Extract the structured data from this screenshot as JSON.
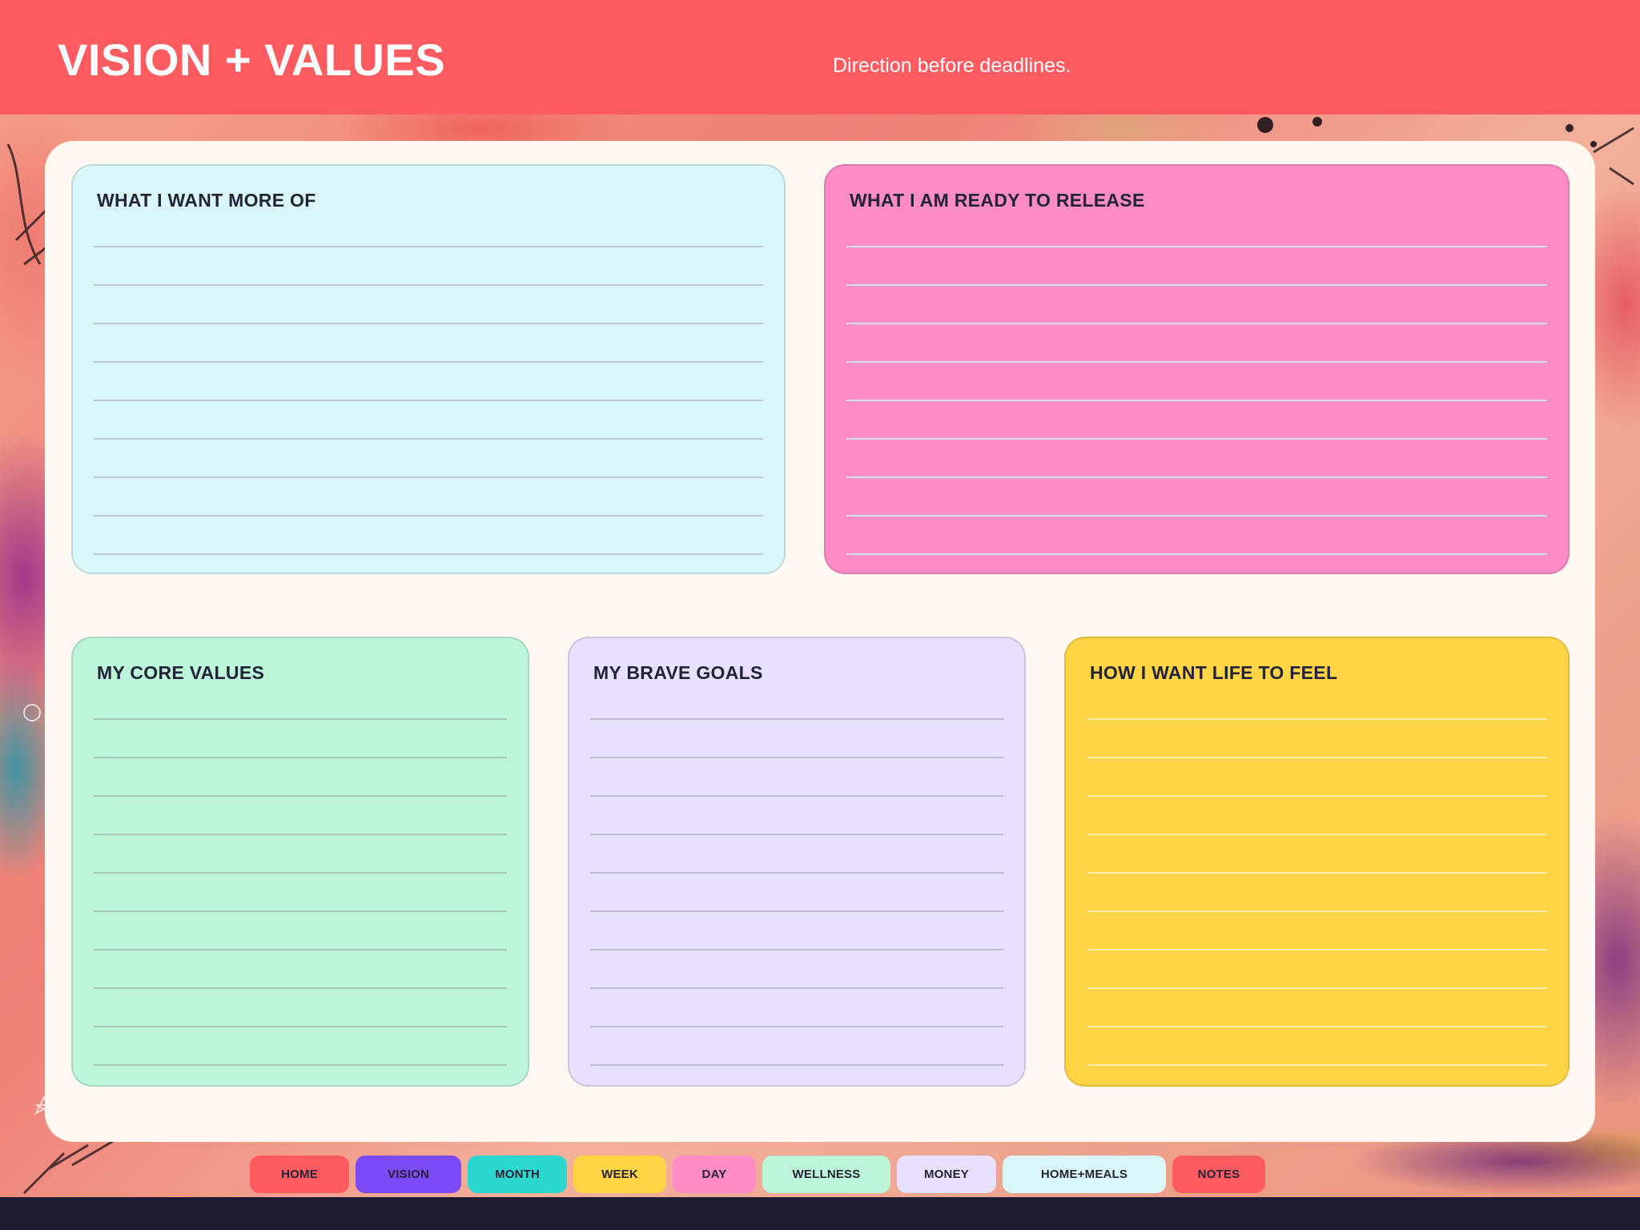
{
  "header": {
    "title": "VISION + VALUES",
    "tagline": "Direction before deadlines."
  },
  "cards": [
    {
      "id": "more-of",
      "title": "WHAT I WANT MORE OF",
      "color": "#d9f7f8"
    },
    {
      "id": "release",
      "title": "WHAT I AM READY TO RELEASE",
      "color": "#ff8cc6"
    },
    {
      "id": "core-values",
      "title": "MY CORE VALUES",
      "color": "#bdf5d9"
    },
    {
      "id": "brave-goals",
      "title": "MY BRAVE GOALS",
      "color": "#e8e0fd"
    },
    {
      "id": "life-feel",
      "title": "HOW I WANT LIFE TO FEEL",
      "color": "#ffd545"
    }
  ],
  "nav": [
    {
      "label": "HOME",
      "color": "#ff5b60"
    },
    {
      "label": "VISION",
      "color": "#7c4bf7"
    },
    {
      "label": "MONTH",
      "color": "#2bd7cf"
    },
    {
      "label": "WEEK",
      "color": "#ffd545"
    },
    {
      "label": "DAY",
      "color": "#ff8cc6"
    },
    {
      "label": "WELLNESS",
      "color": "#bdf5d9"
    },
    {
      "label": "MONEY",
      "color": "#e8e0fd"
    },
    {
      "label": "HOME+MEALS",
      "color": "#d9f7f8"
    },
    {
      "label": "NOTES",
      "color": "#ff5b60"
    }
  ],
  "active_nav": "VISION"
}
